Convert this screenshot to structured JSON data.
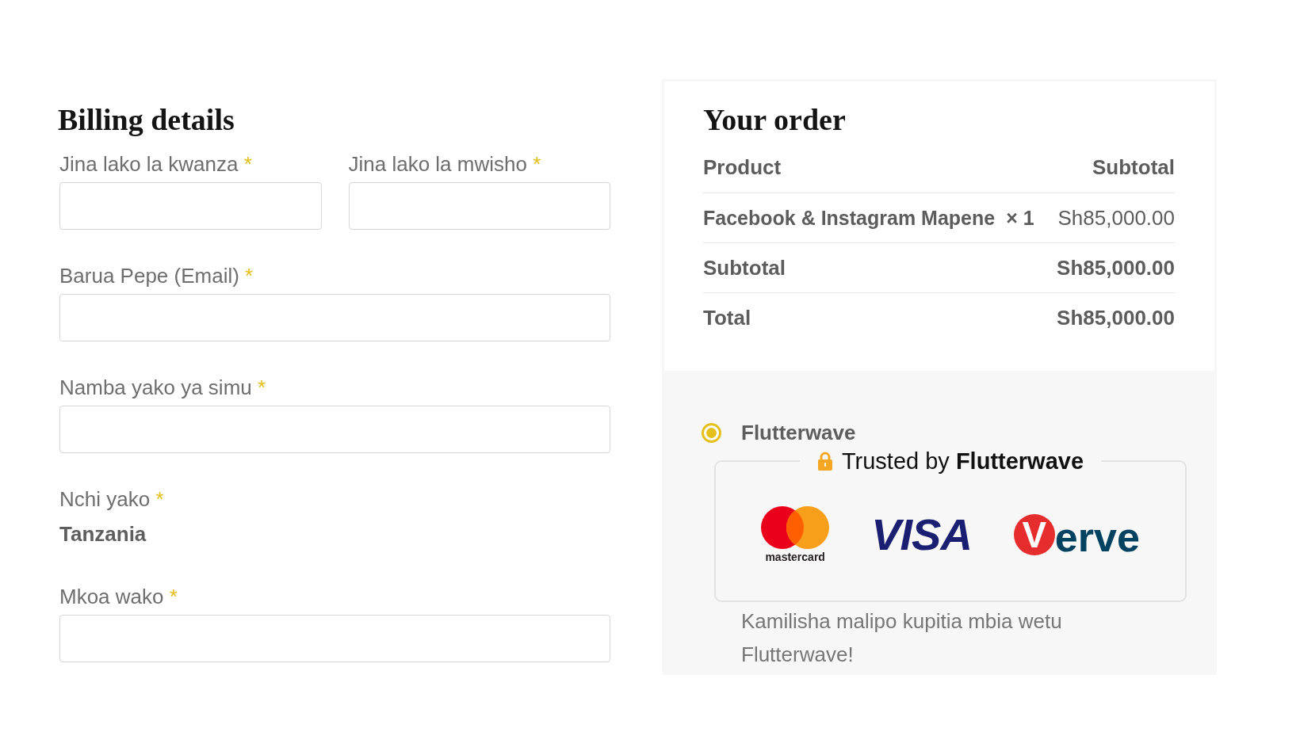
{
  "billing": {
    "title": "Billing details",
    "rows": [
      {
        "fields": [
          {
            "kind": "input",
            "label": "Jina lako la kwanza",
            "required_mark": "*"
          },
          {
            "kind": "input",
            "label": "Jina lako la mwisho",
            "required_mark": "*"
          }
        ]
      },
      {
        "fields": [
          {
            "kind": "input",
            "label": "Barua Pepe (Email)",
            "required_mark": "*"
          }
        ]
      },
      {
        "fields": [
          {
            "kind": "input",
            "label": "Namba yako ya simu",
            "required_mark": "*"
          }
        ]
      },
      {
        "fields": [
          {
            "kind": "static",
            "label": "Nchi yako",
            "required_mark": "*",
            "value": "Tanzania"
          }
        ]
      },
      {
        "fields": [
          {
            "kind": "input",
            "label": "Mkoa wako",
            "required_mark": "*"
          }
        ]
      }
    ]
  },
  "order": {
    "title": "Your order",
    "table": {
      "columns": [
        "Product",
        "Subtotal"
      ],
      "rows": [
        {
          "kind": "item",
          "name": "Facebook & Instagram Mapene",
          "quantity": "× 1",
          "amount": "Sh85,000.00"
        },
        {
          "kind": "subtotal",
          "label": "Subtotal",
          "amount": "Sh85,000.00"
        },
        {
          "kind": "total",
          "label": "Total",
          "amount": "Sh85,000.00"
        }
      ]
    }
  },
  "payment": {
    "methods": [
      {
        "label": "Flutterwave",
        "selected": true,
        "trust_badge": {
          "legend": "Trusted by **Flutterwave**",
          "logos": [
            {
              "kind": "mastercard",
              "wordmark": "mastercard"
            },
            {
              "kind": "visa",
              "wordmark": "VISA"
            },
            {
              "kind": "verve",
              "letter": "V",
              "wordmark": "erve"
            }
          ]
        },
        "description": "Kamilisha malipo kupitia mbia wetu Flutterwave!"
      }
    ]
  }
}
